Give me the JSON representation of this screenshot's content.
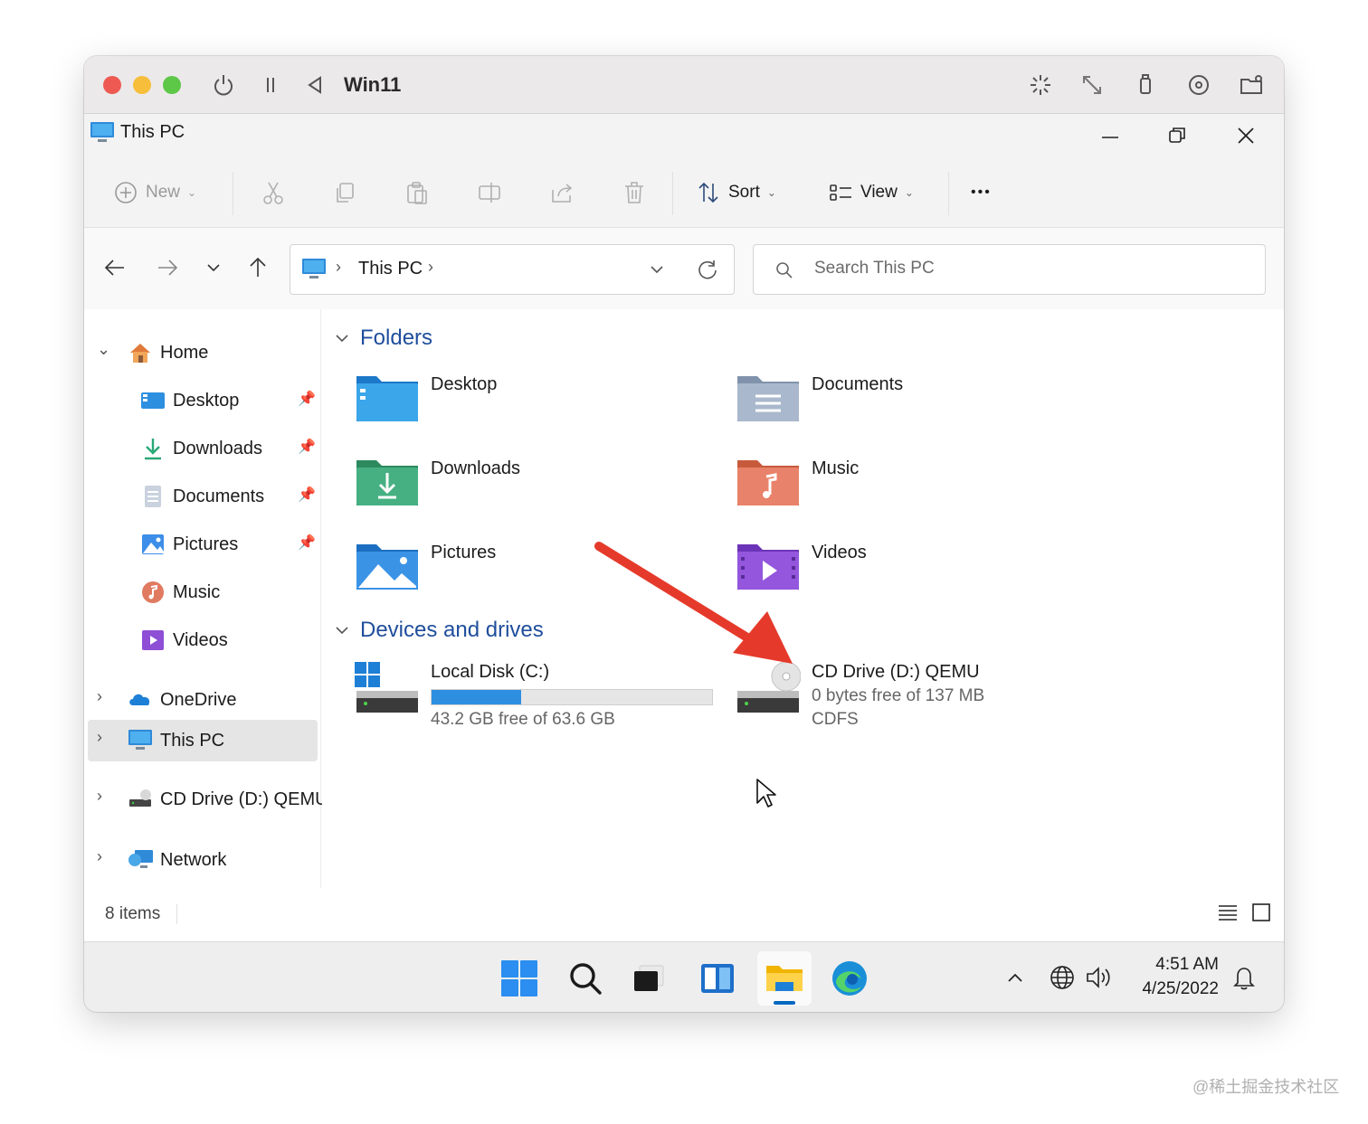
{
  "host": {
    "vm_title": "Win11",
    "icons": [
      "power-icon",
      "pause-icon",
      "back-icon",
      "brightness-icon",
      "resize-icon",
      "usb-icon",
      "disc-icon",
      "folder-share-icon"
    ]
  },
  "window": {
    "title": "This PC",
    "controls": [
      "minimize",
      "restore",
      "close"
    ]
  },
  "toolbar": {
    "new_label": "New",
    "sort_label": "Sort",
    "view_label": "View",
    "more_label": "•••"
  },
  "address": {
    "crumb": "This PC",
    "search_placeholder": "Search This PC"
  },
  "sidebar": {
    "home": "Home",
    "quick": [
      {
        "label": "Desktop",
        "icon": "desktop-icon"
      },
      {
        "label": "Downloads",
        "icon": "downloads-icon"
      },
      {
        "label": "Documents",
        "icon": "documents-icon"
      },
      {
        "label": "Pictures",
        "icon": "pictures-icon"
      },
      {
        "label": "Music",
        "icon": "music-icon"
      },
      {
        "label": "Videos",
        "icon": "videos-icon"
      }
    ],
    "onedrive": "OneDrive",
    "thispc": "This PC",
    "cddrive": "CD Drive (D:) QEMU",
    "network": "Network"
  },
  "content": {
    "folders_header": "Folders",
    "folders": [
      {
        "label": "Desktop"
      },
      {
        "label": "Documents"
      },
      {
        "label": "Downloads"
      },
      {
        "label": "Music"
      },
      {
        "label": "Pictures"
      },
      {
        "label": "Videos"
      }
    ],
    "devices_header": "Devices and drives",
    "drive_c": {
      "name": "Local Disk (C:)",
      "free": "43.2 GB free of 63.6 GB",
      "used_fraction": 0.32
    },
    "drive_d": {
      "name": "CD Drive (D:) QEMU",
      "free": "0 bytes free of 137 MB",
      "fs": "CDFS"
    }
  },
  "status": {
    "items": "8 items"
  },
  "taskbar": {
    "time": "4:51 AM",
    "date": "4/25/2022"
  },
  "watermark": "@稀土掘金技术社区",
  "colors": {
    "accent": "#0067c0",
    "arrow": "#e53a2b",
    "selection": "#e5e5e5"
  }
}
